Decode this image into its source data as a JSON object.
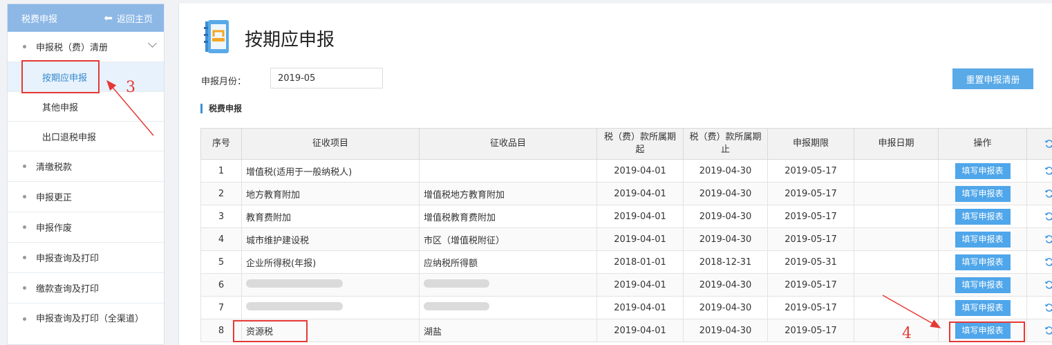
{
  "sidebar": {
    "title": "税费申报",
    "back_label": "返回主页",
    "group_label": "申报税（费）清册",
    "sub_items": [
      "按期应申报",
      "其他申报",
      "出口退税申报"
    ],
    "items": [
      "清缴税款",
      "申报更正",
      "申报作废",
      "申报查询及打印",
      "缴款查询及打印"
    ],
    "last_item": "申报查询及打印（全渠道）"
  },
  "main": {
    "title": "按期应申报",
    "month_label": "申报月份：",
    "month_value": "2019-05",
    "reset_button": "重置申报清册",
    "section_title": "税费申报"
  },
  "table": {
    "headers": [
      "序号",
      "征收项目",
      "征收品目",
      "税（费）款所属期起",
      "税（费）款所属期止",
      "申报期限",
      "申报日期",
      "操作"
    ],
    "action_label": "填写申报表",
    "rows": [
      {
        "no": "1",
        "item": "增值税(适用于一般纳税人)",
        "subitem": "",
        "start": "2019-04-01",
        "end": "2019-04-30",
        "deadline": "2019-05-17",
        "date": ""
      },
      {
        "no": "2",
        "item": "地方教育附加",
        "subitem": "增值税地方教育附加",
        "start": "2019-04-01",
        "end": "2019-04-30",
        "deadline": "2019-05-17",
        "date": ""
      },
      {
        "no": "3",
        "item": "教育费附加",
        "subitem": "增值税教育费附加",
        "start": "2019-04-01",
        "end": "2019-04-30",
        "deadline": "2019-05-17",
        "date": ""
      },
      {
        "no": "4",
        "item": "城市维护建设税",
        "subitem": "市区（增值税附征）",
        "start": "2019-04-01",
        "end": "2019-04-30",
        "deadline": "2019-05-17",
        "date": ""
      },
      {
        "no": "5",
        "item": "企业所得税(年报)",
        "subitem": "应纳税所得额",
        "start": "2018-01-01",
        "end": "2018-12-31",
        "deadline": "2019-05-31",
        "date": ""
      },
      {
        "no": "6",
        "item": "",
        "subitem": "",
        "start": "2019-04-01",
        "end": "2019-04-30",
        "deadline": "2019-05-17",
        "date": ""
      },
      {
        "no": "7",
        "item": "",
        "subitem": "",
        "start": "2019-04-01",
        "end": "2019-04-30",
        "deadline": "2019-05-17",
        "date": ""
      },
      {
        "no": "8",
        "item": "资源税",
        "subitem": "湖盐",
        "start": "2019-04-01",
        "end": "2019-04-30",
        "deadline": "2019-05-17",
        "date": ""
      }
    ]
  },
  "annotations": {
    "step3": "3",
    "step4": "4"
  },
  "colors": {
    "accent": "#5aaae8",
    "header": "#8db8e6",
    "annotation": "#e53935"
  }
}
